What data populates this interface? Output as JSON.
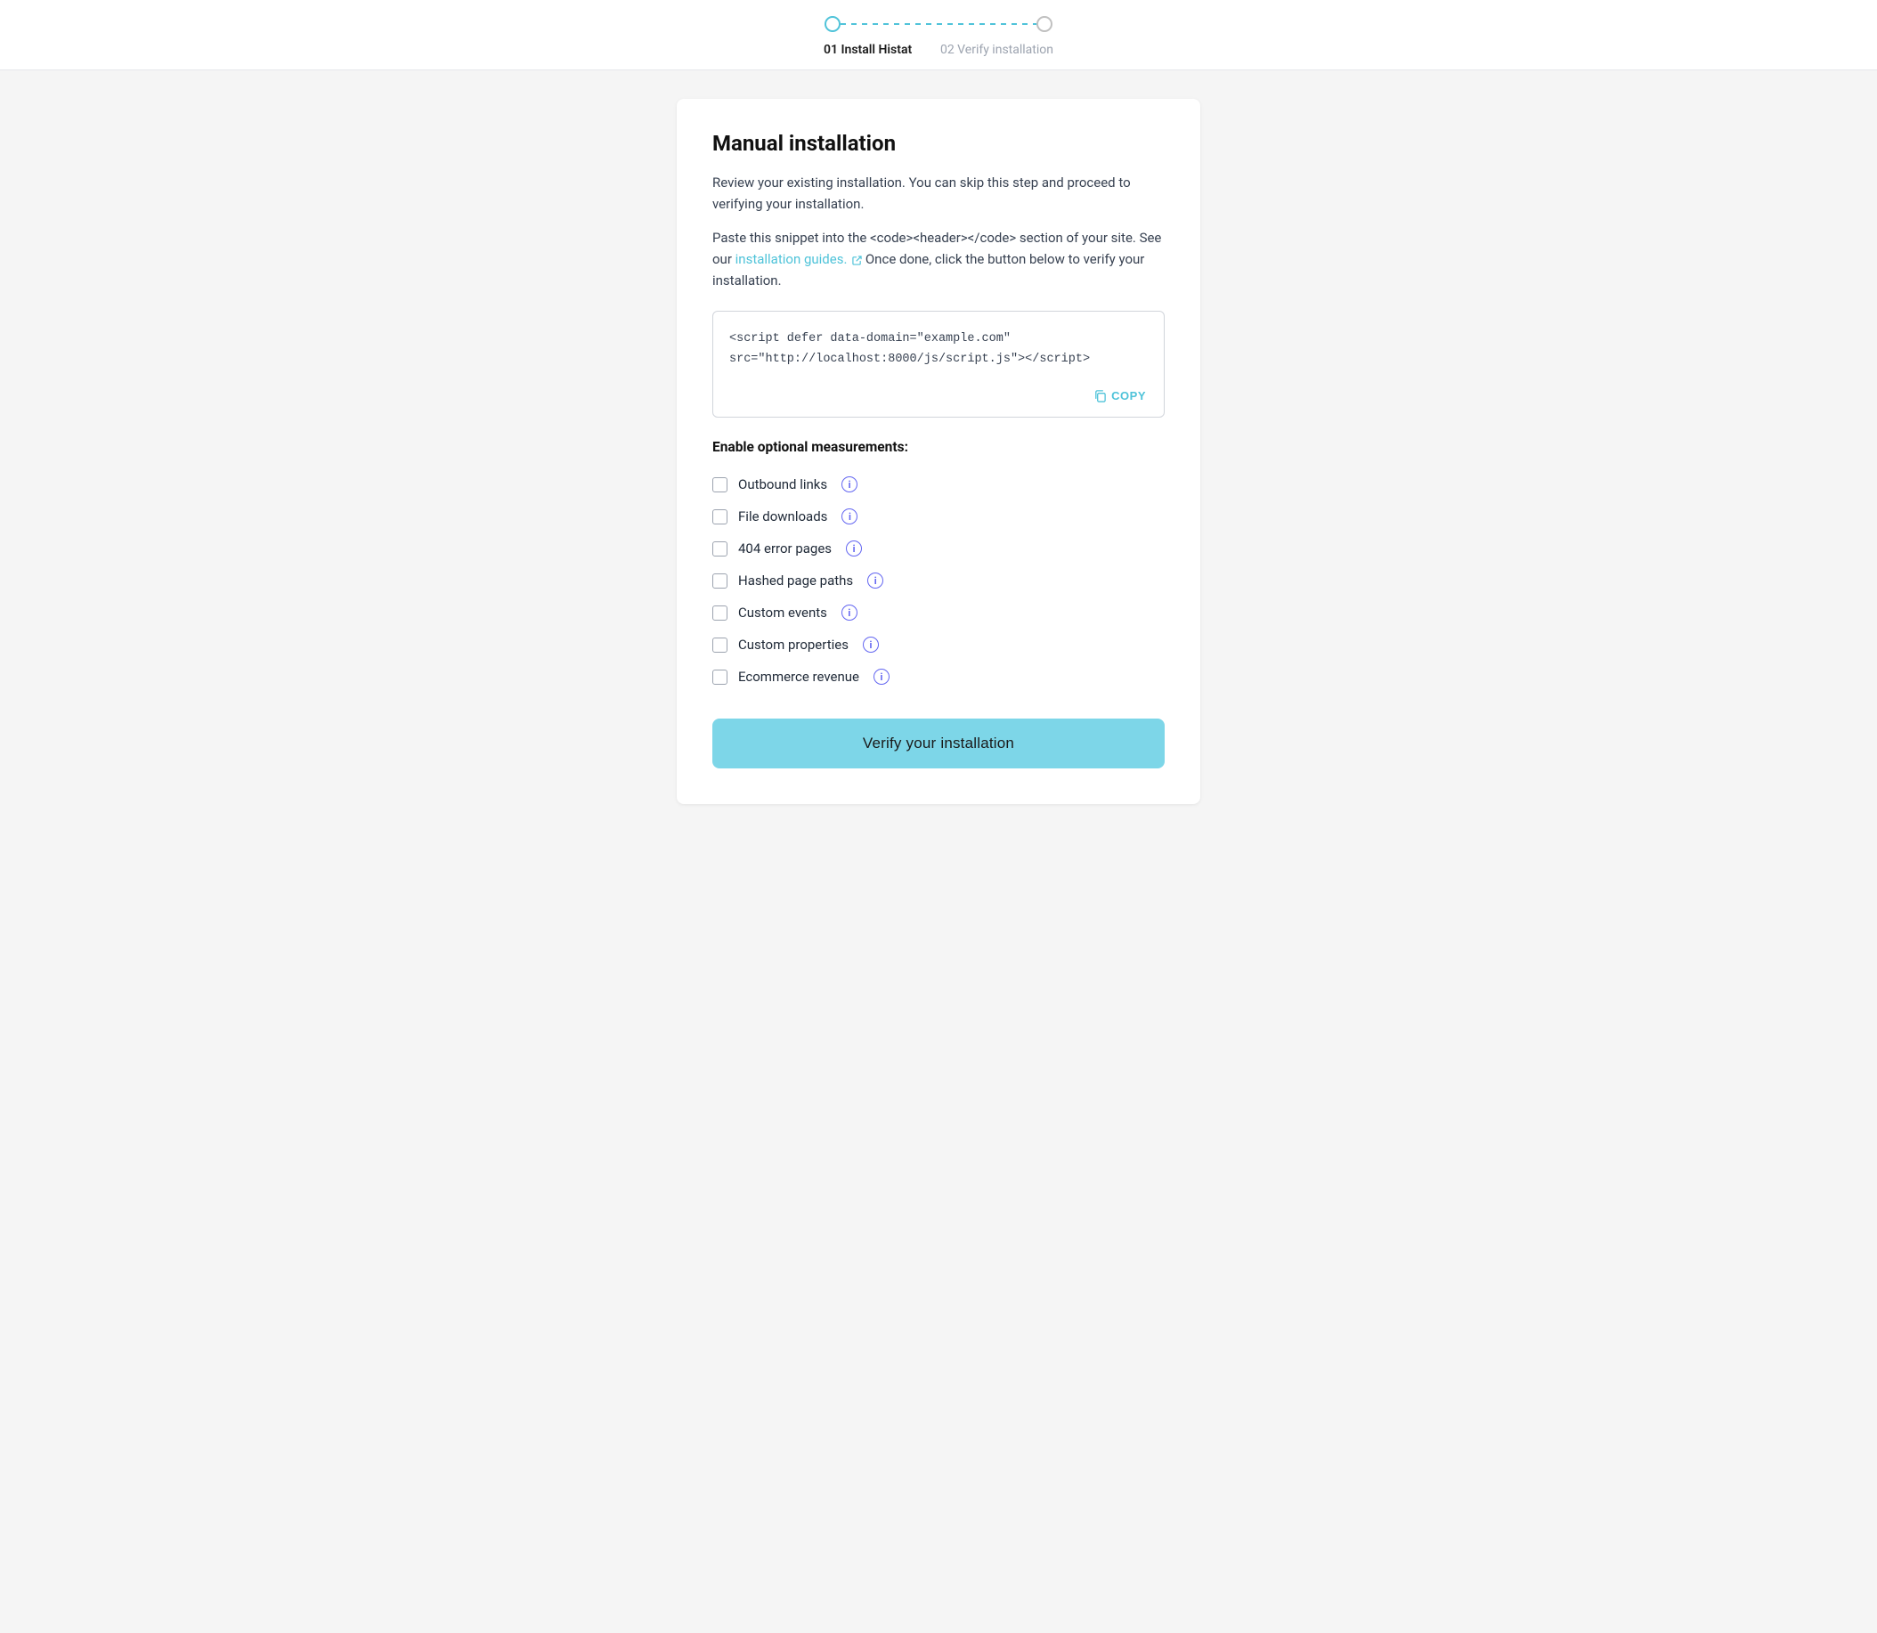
{
  "stepper": {
    "step1_label": "01 Install Histat",
    "step2_label": "02 Verify installation"
  },
  "card": {
    "title": "Manual installation",
    "desc1": "Review your existing installation. You can skip this step and proceed to verifying your installation.",
    "desc2_before": "Paste this snippet into the <code><header></code> section of your site. See our ",
    "desc2_link": "installation guides.",
    "desc2_after": " Once done, click the button below to verify your installation.",
    "code_snippet": "<script defer data-domain=\"example.com\"\nsrc=\"http://localhost:8000/js/script.js\"></script>",
    "copy_label": "COPY",
    "measurements_title": "Enable optional measurements:",
    "checkboxes": [
      {
        "id": "outbound",
        "label": "Outbound links"
      },
      {
        "id": "file-downloads",
        "label": "File downloads"
      },
      {
        "id": "error-pages",
        "label": "404 error pages"
      },
      {
        "id": "hashed-paths",
        "label": "Hashed page paths"
      },
      {
        "id": "custom-events",
        "label": "Custom events"
      },
      {
        "id": "custom-props",
        "label": "Custom properties"
      },
      {
        "id": "ecommerce",
        "label": "Ecommerce revenue"
      }
    ],
    "verify_btn_label": "Verify your installation"
  }
}
